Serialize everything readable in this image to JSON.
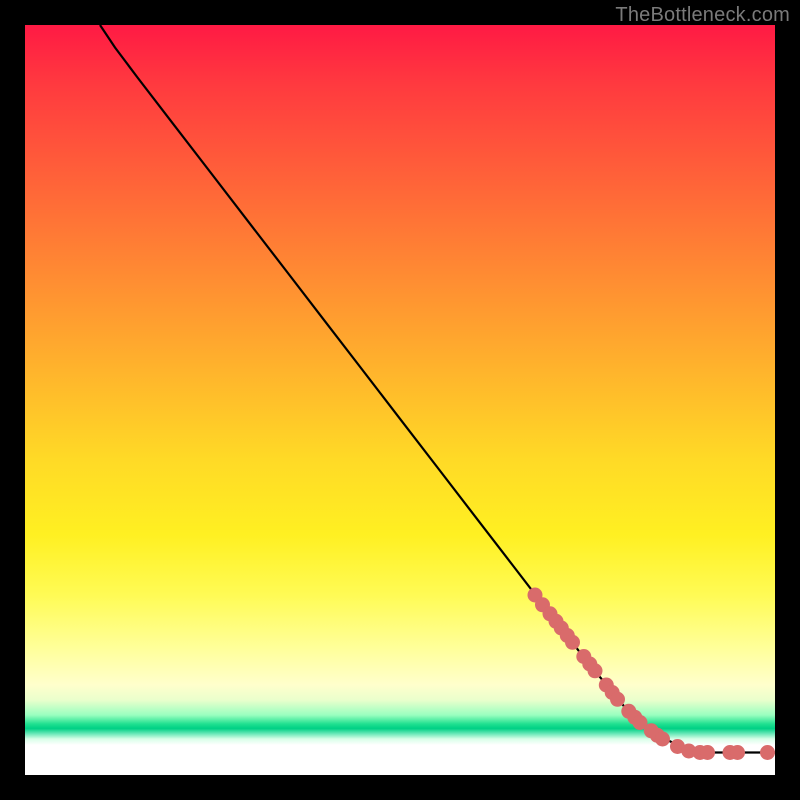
{
  "watermark": "TheBottleneck.com",
  "colors": {
    "background": "#000000",
    "curve": "#000000",
    "marker": "#d96b6b",
    "marker_stroke": "#c85a5a"
  },
  "chart_data": {
    "type": "line",
    "title": "",
    "xlabel": "",
    "ylabel": "",
    "xlim": [
      0,
      100
    ],
    "ylim": [
      0,
      100
    ],
    "grid": false,
    "legend": false,
    "series": [
      {
        "name": "curve",
        "x": [
          10,
          12,
          15,
          20,
          25,
          30,
          35,
          40,
          45,
          50,
          55,
          60,
          65,
          70,
          72,
          75,
          78,
          80,
          82,
          85,
          88,
          90,
          92,
          94,
          96,
          98,
          100
        ],
        "y": [
          100,
          97,
          93,
          86.5,
          80,
          73.5,
          67,
          60.5,
          54,
          47.5,
          41,
          34.5,
          28,
          21.5,
          19,
          15,
          11.5,
          9,
          7,
          5,
          3.5,
          3,
          3,
          3,
          3,
          3,
          3
        ]
      }
    ],
    "markers": [
      {
        "x": 68.0,
        "y": 24.0
      },
      {
        "x": 69.0,
        "y": 22.7
      },
      {
        "x": 70.0,
        "y": 21.5
      },
      {
        "x": 70.8,
        "y": 20.5
      },
      {
        "x": 71.5,
        "y": 19.6
      },
      {
        "x": 72.3,
        "y": 18.6
      },
      {
        "x": 73.0,
        "y": 17.7
      },
      {
        "x": 74.5,
        "y": 15.8
      },
      {
        "x": 75.3,
        "y": 14.8
      },
      {
        "x": 76.0,
        "y": 13.9
      },
      {
        "x": 77.5,
        "y": 12.0
      },
      {
        "x": 78.3,
        "y": 11.0
      },
      {
        "x": 79.0,
        "y": 10.1
      },
      {
        "x": 80.5,
        "y": 8.5
      },
      {
        "x": 81.3,
        "y": 7.7
      },
      {
        "x": 82.0,
        "y": 7.0
      },
      {
        "x": 83.5,
        "y": 5.9
      },
      {
        "x": 84.3,
        "y": 5.3
      },
      {
        "x": 85.0,
        "y": 4.8
      },
      {
        "x": 87.0,
        "y": 3.8
      },
      {
        "x": 88.5,
        "y": 3.2
      },
      {
        "x": 90.0,
        "y": 3.0
      },
      {
        "x": 91.0,
        "y": 3.0
      },
      {
        "x": 94.0,
        "y": 3.0
      },
      {
        "x": 95.0,
        "y": 3.0
      },
      {
        "x": 99.0,
        "y": 3.0
      }
    ]
  }
}
